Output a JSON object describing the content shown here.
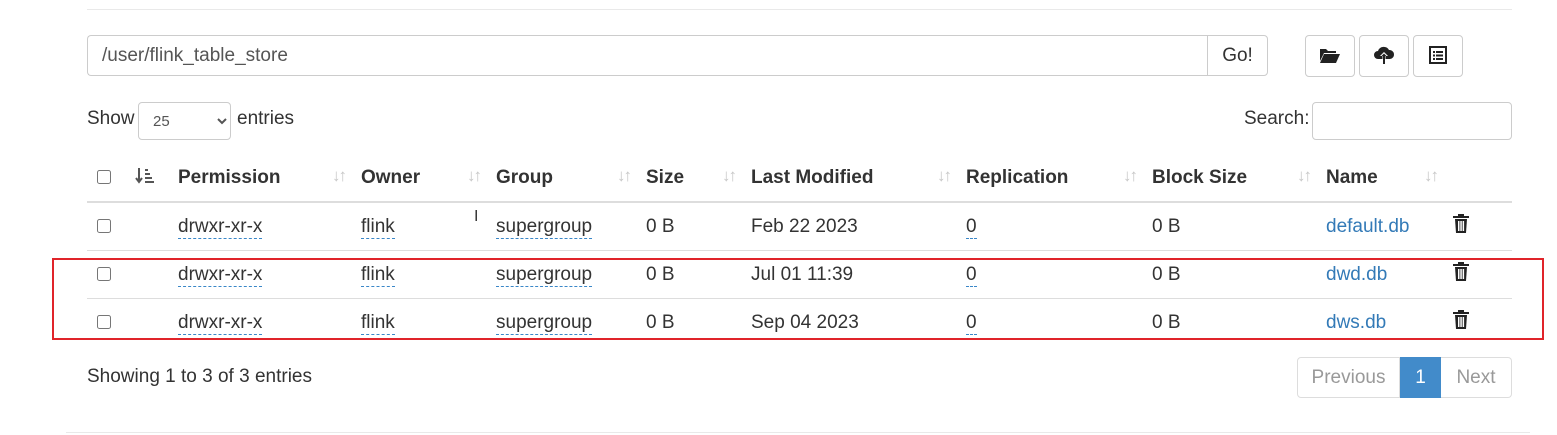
{
  "path_bar": {
    "value": "/user/flink_table_store",
    "go_label": "Go!"
  },
  "toolbar": {
    "icons": [
      "folder-open-icon",
      "cloud-upload-icon",
      "list-alt-icon"
    ]
  },
  "length_menu": {
    "show_label": "Show",
    "selected": "25",
    "entries_label": "entries"
  },
  "search": {
    "label": "Search:",
    "value": ""
  },
  "table": {
    "headers": [
      "Permission",
      "Owner",
      "Group",
      "Size",
      "Last Modified",
      "Replication",
      "Block Size",
      "Name"
    ],
    "rows": [
      {
        "permission": "drwxr-xr-x",
        "owner": "flink",
        "group": "supergroup",
        "size": "0 B",
        "modified": "Feb 22 2023",
        "replication": "0",
        "block_size": "0 B",
        "name": "default.db"
      },
      {
        "permission": "drwxr-xr-x",
        "owner": "flink",
        "group": "supergroup",
        "size": "0 B",
        "modified": "Jul 01 11:39",
        "replication": "0",
        "block_size": "0 B",
        "name": "dwd.db"
      },
      {
        "permission": "drwxr-xr-x",
        "owner": "flink",
        "group": "supergroup",
        "size": "0 B",
        "modified": "Sep 04 2023",
        "replication": "0",
        "block_size": "0 B",
        "name": "dws.db"
      }
    ]
  },
  "info": "Showing 1 to 3 of 3 entries",
  "pagination": {
    "previous": "Previous",
    "current": "1",
    "next": "Next"
  },
  "colors": {
    "link": "#337ab7",
    "active_page": "#428bca",
    "highlight_border": "#e0242a"
  }
}
